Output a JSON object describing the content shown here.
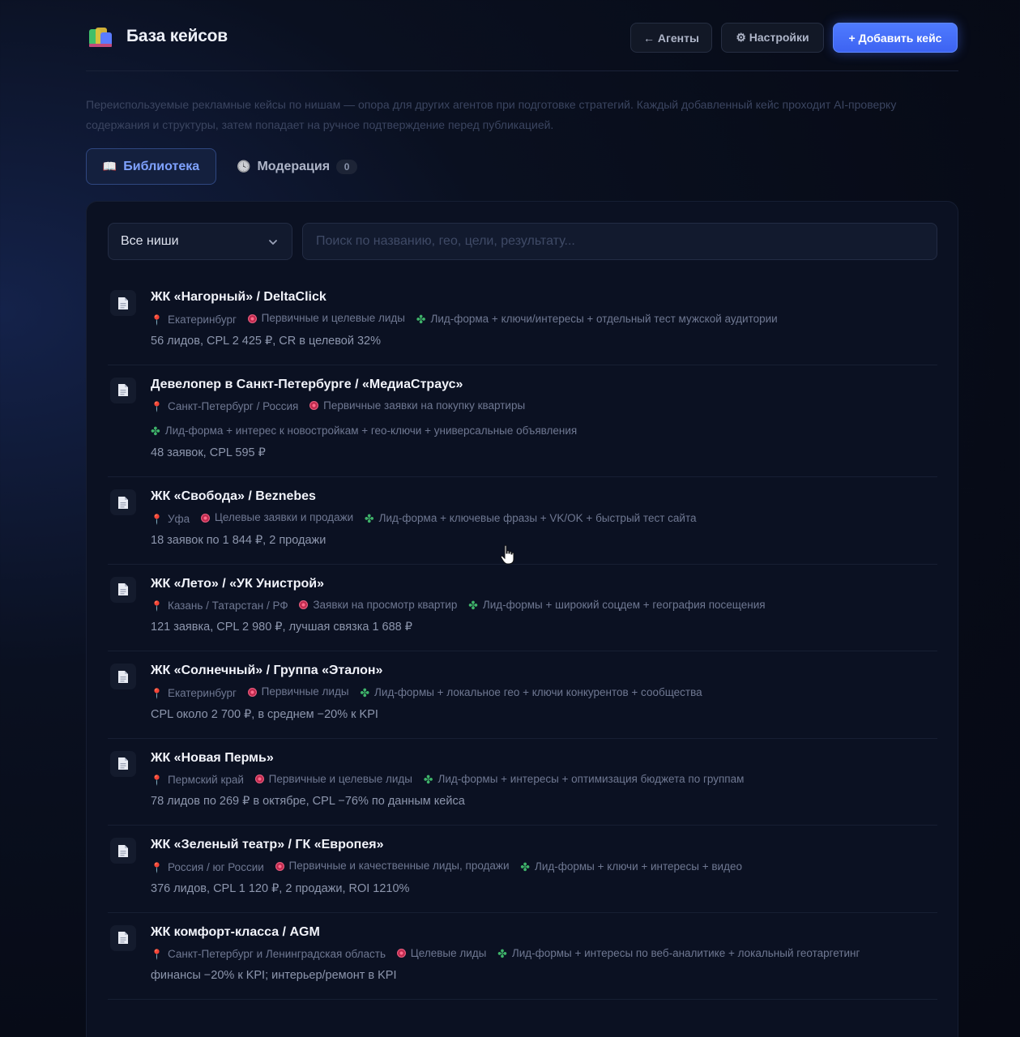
{
  "header": {
    "title": "База кейсов",
    "agents_label": "← Агенты",
    "settings_label": "⚙ Настройки",
    "add_label": "+ Добавить кейс"
  },
  "description": "Переиспользуемые рекламные кейсы по нишам — опора для других агентов при подготовке стратегий. Каждый добавленный кейс проходит AI-проверку содержания и структуры, затем попадает на ручное подтверждение перед публикацией.",
  "tabs": {
    "library": {
      "icon": "📖",
      "label": "Библиотека"
    },
    "moderation": {
      "icon": "🕓",
      "label": "Модерация",
      "count": "0"
    }
  },
  "filters": {
    "niche_selected": "Все ниши",
    "search_placeholder": "Поиск по названию, гео, цели, результату..."
  },
  "cases": [
    {
      "title": "ЖК «Нагорный» / DeltaClick",
      "geo": "Екатеринбург",
      "goal": "Первичные и целевые лиды",
      "tools": "Лид-форма + ключи/интересы + отдельный тест мужской аудитории",
      "result": "56 лидов, CPL 2 425 ₽, CR в целевой 32%",
      "wrap": false
    },
    {
      "title": "Девелопер в Санкт-Петербурге / «МедиаСтраус»",
      "geo": "Санкт-Петербург / Россия",
      "goal": "Первичные заявки на покупку квартиры",
      "tools": "Лид-форма + интерес к новостройкам + гео-ключи + универсальные объявления",
      "result": "48 заявок, CPL 595 ₽",
      "wrap": true
    },
    {
      "title": "ЖК «Свобода» / Beznebes",
      "geo": "Уфа",
      "goal": "Целевые заявки и продажи",
      "tools": "Лид-форма + ключевые фразы + VK/OK + быстрый тест сайта",
      "result": "18 заявок по 1 844 ₽, 2 продажи",
      "wrap": false
    },
    {
      "title": "ЖК «Лето» / «УК Унистрой»",
      "geo": "Казань / Татарстан / РФ",
      "goal": "Заявки на просмотр квартир",
      "tools": "Лид-формы + широкий соцдем + география посещения",
      "result": "121 заявка, CPL 2 980 ₽, лучшая связка 1 688 ₽",
      "wrap": false
    },
    {
      "title": "ЖК «Солнечный» / Группа «Эталон»",
      "geo": "Екатеринбург",
      "goal": "Первичные лиды",
      "tools": "Лид-формы + локальное гео + ключи конкурентов + сообщества",
      "result": "CPL около 2 700 ₽, в среднем −20% к KPI",
      "wrap": false
    },
    {
      "title": "ЖК «Новая Пермь»",
      "geo": "Пермский край",
      "goal": "Первичные и целевые лиды",
      "tools": "Лид-формы + интересы + оптимизация бюджета по группам",
      "result": "78 лидов по 269 ₽ в октябре, CPL −76% по данным кейса",
      "wrap": false
    },
    {
      "title": "ЖК «Зеленый театр» / ГК «Европея»",
      "geo": "Россия / юг России",
      "goal": "Первичные и качественные лиды, продажи",
      "tools": "Лид-формы + ключи + интересы + видео",
      "result": "376 лидов, CPL 1 120 ₽, 2 продажи, ROI 1210%",
      "wrap": false
    },
    {
      "title": "ЖК комфорт-класса / AGM",
      "geo": "Санкт-Петербург и Ленинградская область",
      "goal": "Целевые лиды",
      "tools": "Лид-формы + интересы по веб-аналитике + локальный геотаргетинг",
      "result": "финансы −20% к KPI; интерьер/ремонт в KPI",
      "wrap": false
    }
  ]
}
